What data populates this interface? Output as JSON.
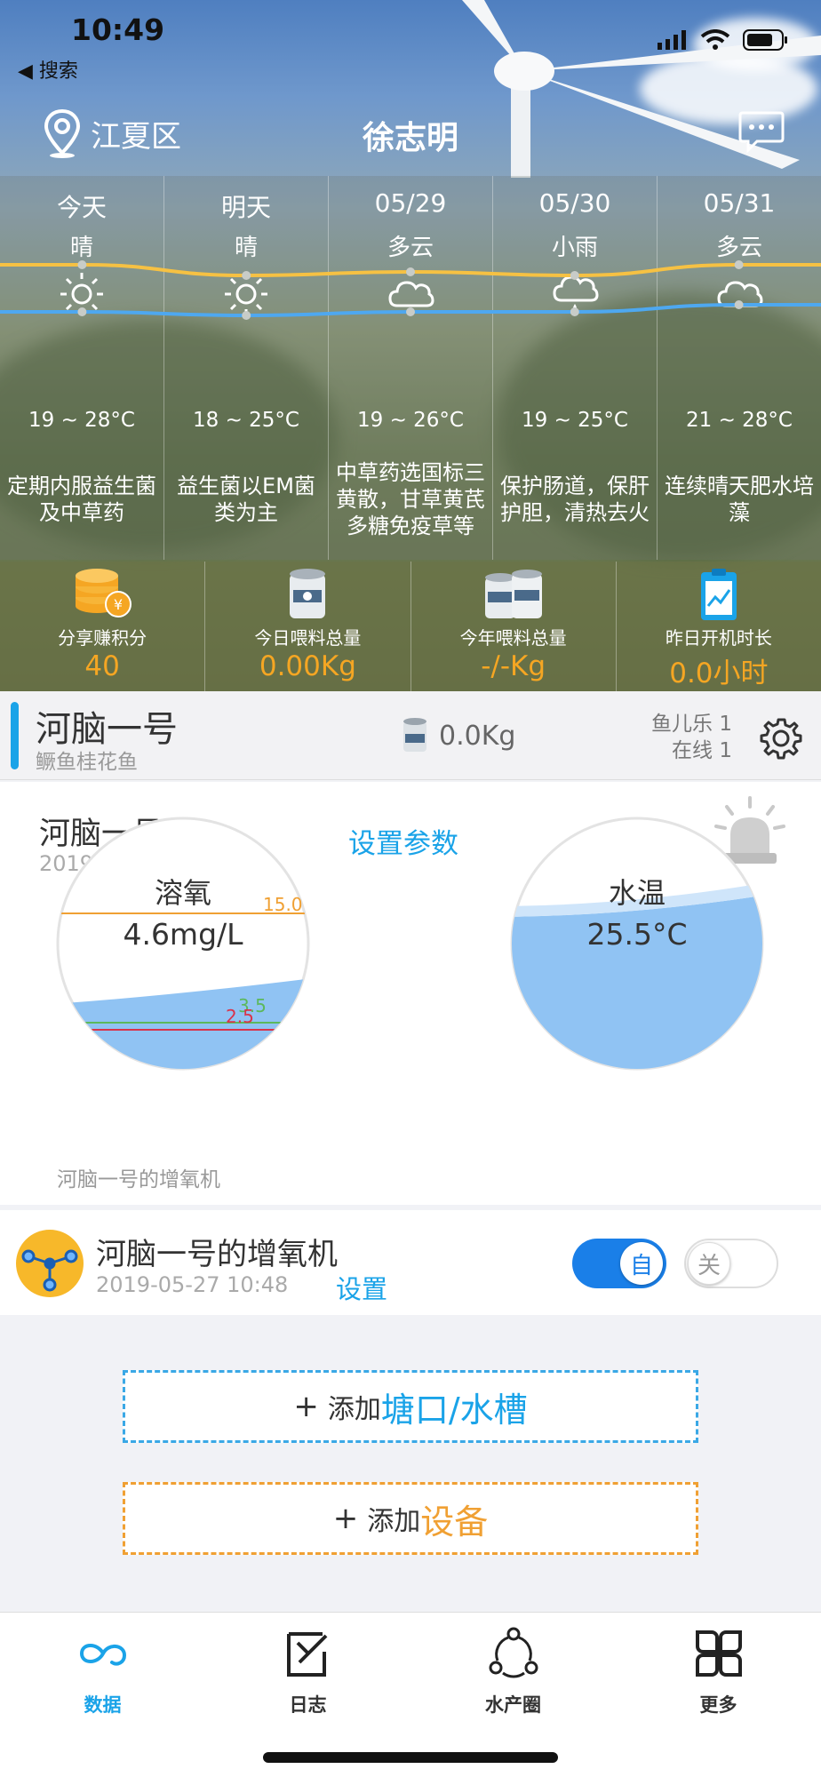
{
  "status": {
    "time": "10:49",
    "back_label": "◀ 搜索"
  },
  "header": {
    "location": "江夏区",
    "title": "徐志明"
  },
  "forecast": [
    {
      "day": "今天",
      "condition": "晴",
      "icon": "sun-icon",
      "temp": "19 ~ 28°C",
      "advice": "定期内服益生菌及中草药",
      "high": 28,
      "low": 19
    },
    {
      "day": "明天",
      "condition": "晴",
      "icon": "sun-icon",
      "temp": "18 ~ 25°C",
      "advice": "益生菌以EM菌类为主",
      "high": 25,
      "low": 18
    },
    {
      "day": "05/29",
      "condition": "多云",
      "icon": "cloud-icon",
      "temp": "19 ~ 26°C",
      "advice": "中草药选国标三黄散，甘草黄芪多糖免疫草等",
      "high": 26,
      "low": 19
    },
    {
      "day": "05/30",
      "condition": "小雨",
      "icon": "rain-cloud-icon",
      "temp": "19 ~ 25°C",
      "advice": "保护肠道，保肝护胆，清热去火",
      "high": 25,
      "low": 19
    },
    {
      "day": "05/31",
      "condition": "多云",
      "icon": "cloud-icon",
      "temp": "21 ~ 28°C",
      "advice": "连续晴天肥水培藻",
      "high": 28,
      "low": 21
    }
  ],
  "stats": [
    {
      "label": "分享赚积分",
      "value": "40",
      "icon": "coins-icon"
    },
    {
      "label": "今日喂料总量",
      "value": "0.00Kg",
      "icon": "feed-can-icon"
    },
    {
      "label": "今年喂料总量",
      "value": "-/-Kg",
      "icon": "feed-cans-icon"
    },
    {
      "label": "昨日开机时长",
      "value": "0.0小时",
      "icon": "clipboard-chart-icon"
    }
  ],
  "pond": {
    "name": "河脑一号",
    "species": "鳜鱼桂花鱼",
    "feed": "0.0Kg",
    "count_line1": "鱼儿乐 1",
    "count_line2": "在线 1"
  },
  "device": {
    "name": "河脑一号",
    "date": "2019-05-27 10:48",
    "settings_label": "设置参数",
    "oxygen": {
      "label": "溶氧",
      "value": "4.6mg/L",
      "upper": "15.0",
      "mid": "3.5",
      "lower": "2.5"
    },
    "temperature": {
      "label": "水温",
      "value": "25.5°C"
    },
    "caption": "河脑一号的增氧机"
  },
  "aerator": {
    "name": "河脑一号的增氧机",
    "date": "2019-05-27 10:48",
    "settings_label": "设置",
    "auto_label": "自",
    "off_label": "关"
  },
  "add_pond": {
    "prefix": "添加",
    "highlight": "塘口/水槽"
  },
  "add_device": {
    "prefix": "添加",
    "highlight": "设备"
  },
  "tabs": [
    {
      "label": "数据",
      "icon": "infinity-data-icon",
      "active": true
    },
    {
      "label": "日志",
      "icon": "log-edit-icon",
      "active": false
    },
    {
      "label": "水产圈",
      "icon": "community-icon",
      "active": false
    },
    {
      "label": "更多",
      "icon": "grid-more-icon",
      "active": false
    }
  ],
  "colors": {
    "accent": "#1aa3e8",
    "orange": "#f5a623",
    "high_line": "#f6c143",
    "low_line": "#4ea8f0"
  }
}
